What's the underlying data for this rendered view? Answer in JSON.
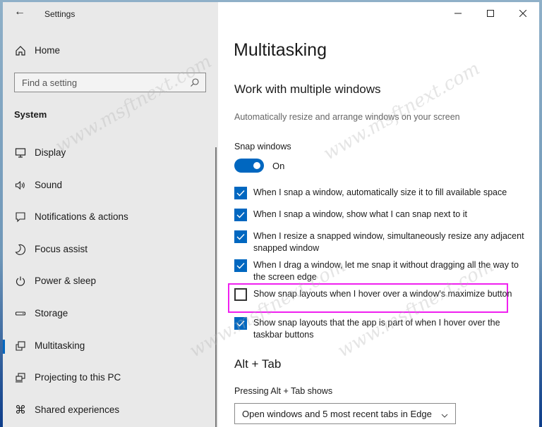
{
  "window": {
    "title": "Settings",
    "controls": {
      "minimize": "minimize",
      "maximize": "maximize",
      "close": "close"
    }
  },
  "sidebar": {
    "home_label": "Home",
    "search_placeholder": "Find a setting",
    "section_title": "System",
    "items": [
      {
        "label": "Display",
        "icon": "monitor-icon"
      },
      {
        "label": "Sound",
        "icon": "speaker-icon"
      },
      {
        "label": "Notifications & actions",
        "icon": "notification-icon"
      },
      {
        "label": "Focus assist",
        "icon": "moon-icon"
      },
      {
        "label": "Power & sleep",
        "icon": "power-icon"
      },
      {
        "label": "Storage",
        "icon": "storage-icon"
      },
      {
        "label": "Multitasking",
        "icon": "multitasking-icon",
        "active": true
      },
      {
        "label": "Projecting to this PC",
        "icon": "projecting-icon"
      },
      {
        "label": "Shared experiences",
        "icon": "shared-experiences-icon"
      }
    ]
  },
  "main": {
    "title": "Multitasking",
    "section1": {
      "title": "Work with multiple windows",
      "description": "Automatically resize and arrange windows on your screen",
      "snap_label": "Snap windows",
      "snap_state": "On",
      "checkboxes": [
        {
          "label": "When I snap a window, automatically size it to fill available space",
          "checked": true
        },
        {
          "label": "When I snap a window, show what I can snap next to it",
          "checked": true
        },
        {
          "label": "When I resize a snapped window, simultaneously resize any adjacent snapped window",
          "checked": true
        },
        {
          "label": "When I drag a window, let me snap it without dragging all the way to the screen edge",
          "checked": true
        },
        {
          "label": "Show snap layouts when I hover over a window's maximize button",
          "checked": false,
          "highlighted": true
        },
        {
          "label": "Show snap layouts that the app is part of when I hover over the taskbar buttons",
          "checked": true
        }
      ]
    },
    "section2": {
      "title": "Alt + Tab",
      "label": "Pressing Alt + Tab shows",
      "dropdown_value": "Open windows and 5 most recent tabs in Edge"
    }
  },
  "watermark": "www.msftnext.com",
  "colors": {
    "accent": "#0067c0",
    "highlight": "#f020f0",
    "sidebar_bg": "#e9e9e9"
  }
}
